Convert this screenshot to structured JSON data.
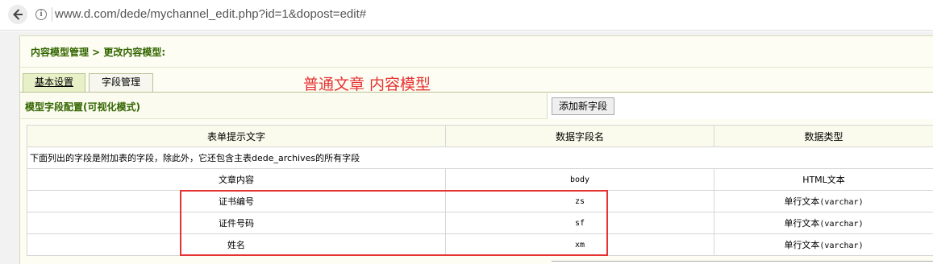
{
  "browser": {
    "url": "www.d.com/dede/mychannel_edit.php?id=1&dopost=edit#",
    "back_icon": "arrow-left-icon",
    "info_icon": "info-icon"
  },
  "breadcrumb": "内容模型管理 > 更改内容模型:",
  "tabs": [
    {
      "label": "基本设置"
    },
    {
      "label": "字段管理"
    }
  ],
  "annotation_title": "普通文章  内容模型",
  "section": {
    "title": "模型字段配置(可视化模式)",
    "add_button": "添加新字段"
  },
  "table": {
    "headers": [
      "表单提示文字",
      "数据字段名",
      "数据类型"
    ],
    "note": "下面列出的字段是附加表的字段，除此外，它还包含主表dede_archives的所有字段",
    "rows": [
      {
        "label": "文章内容",
        "field": "body",
        "type": "HTML文本"
      },
      {
        "label": "证书编号",
        "field": "zs",
        "type_prefix": "单行文本",
        "type_code": "(varchar)"
      },
      {
        "label": "证件号码",
        "field": "sf",
        "type_prefix": "单行文本",
        "type_code": "(varchar)"
      },
      {
        "label": "姓名",
        "field": "xm",
        "type_prefix": "单行文本",
        "type_code": "(varchar)"
      }
    ]
  },
  "colors": {
    "annotation_red": "#e53333",
    "breadcrumb_green": "#336600",
    "tab_active_bg": "#e8f0c8"
  }
}
